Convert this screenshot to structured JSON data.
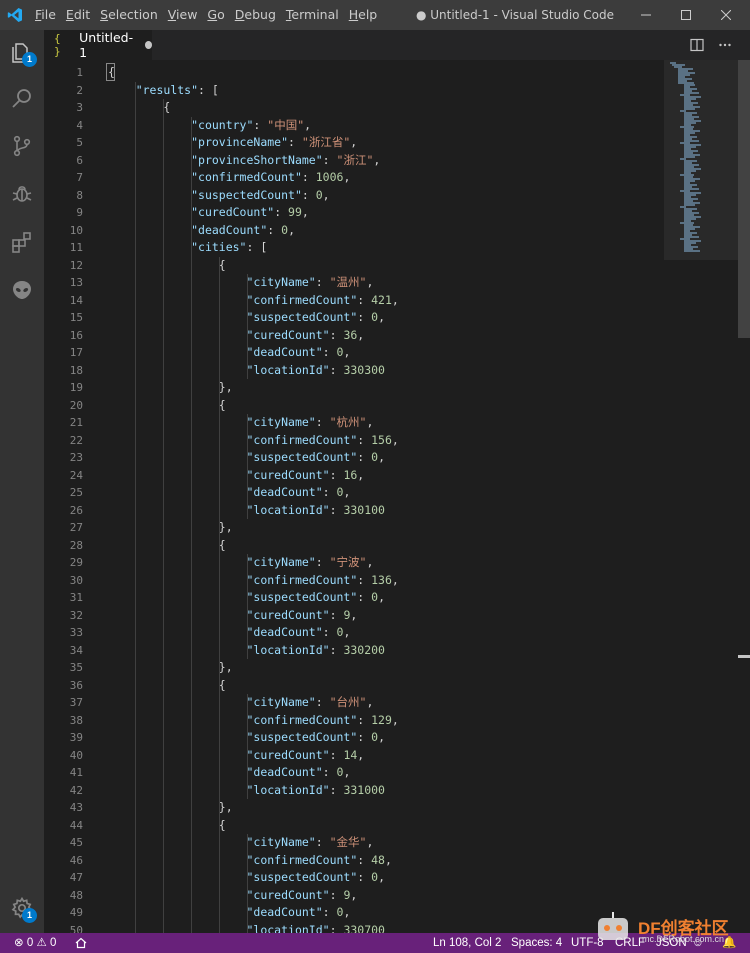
{
  "window": {
    "title": "● Untitled-1 - Visual Studio Code",
    "menu": [
      {
        "label": "File",
        "mnemonic": "F",
        "rest": "ile"
      },
      {
        "label": "Edit",
        "mnemonic": "E",
        "rest": "dit"
      },
      {
        "label": "Selection",
        "mnemonic": "S",
        "rest": "election"
      },
      {
        "label": "View",
        "mnemonic": "V",
        "rest": "iew"
      },
      {
        "label": "Go",
        "mnemonic": "G",
        "rest": "o"
      },
      {
        "label": "Debug",
        "mnemonic": "D",
        "rest": "ebug"
      },
      {
        "label": "Terminal",
        "mnemonic": "T",
        "rest": "erminal"
      },
      {
        "label": "Help",
        "mnemonic": "H",
        "rest": "elp"
      }
    ]
  },
  "activity": {
    "explorer_badge": "1",
    "settings_badge": "1"
  },
  "tab": {
    "icon": "{ }",
    "label": "Untitled-1"
  },
  "editor": {
    "lines": [
      [
        [
          "p",
          "{"
        ]
      ],
      [
        [
          "i",
          "    "
        ],
        [
          "k",
          "\"results\""
        ],
        [
          "p",
          ": ["
        ]
      ],
      [
        [
          "i",
          "        "
        ],
        [
          "p",
          "{"
        ]
      ],
      [
        [
          "i",
          "            "
        ],
        [
          "k",
          "\"country\""
        ],
        [
          "p",
          ": "
        ],
        [
          "s",
          "\"中国\""
        ],
        [
          "p",
          ","
        ]
      ],
      [
        [
          "i",
          "            "
        ],
        [
          "k",
          "\"provinceName\""
        ],
        [
          "p",
          ": "
        ],
        [
          "s",
          "\"浙江省\""
        ],
        [
          "p",
          ","
        ]
      ],
      [
        [
          "i",
          "            "
        ],
        [
          "k",
          "\"provinceShortName\""
        ],
        [
          "p",
          ": "
        ],
        [
          "s",
          "\"浙江\""
        ],
        [
          "p",
          ","
        ]
      ],
      [
        [
          "i",
          "            "
        ],
        [
          "k",
          "\"confirmedCount\""
        ],
        [
          "p",
          ": "
        ],
        [
          "n",
          "1006"
        ],
        [
          "p",
          ","
        ]
      ],
      [
        [
          "i",
          "            "
        ],
        [
          "k",
          "\"suspectedCount\""
        ],
        [
          "p",
          ": "
        ],
        [
          "n",
          "0"
        ],
        [
          "p",
          ","
        ]
      ],
      [
        [
          "i",
          "            "
        ],
        [
          "k",
          "\"curedCount\""
        ],
        [
          "p",
          ": "
        ],
        [
          "n",
          "99"
        ],
        [
          "p",
          ","
        ]
      ],
      [
        [
          "i",
          "            "
        ],
        [
          "k",
          "\"deadCount\""
        ],
        [
          "p",
          ": "
        ],
        [
          "n",
          "0"
        ],
        [
          "p",
          ","
        ]
      ],
      [
        [
          "i",
          "            "
        ],
        [
          "k",
          "\"cities\""
        ],
        [
          "p",
          ": ["
        ]
      ],
      [
        [
          "i",
          "                "
        ],
        [
          "p",
          "{"
        ]
      ],
      [
        [
          "i",
          "                    "
        ],
        [
          "k",
          "\"cityName\""
        ],
        [
          "p",
          ": "
        ],
        [
          "s",
          "\"温州\""
        ],
        [
          "p",
          ","
        ]
      ],
      [
        [
          "i",
          "                    "
        ],
        [
          "k",
          "\"confirmedCount\""
        ],
        [
          "p",
          ": "
        ],
        [
          "n",
          "421"
        ],
        [
          "p",
          ","
        ]
      ],
      [
        [
          "i",
          "                    "
        ],
        [
          "k",
          "\"suspectedCount\""
        ],
        [
          "p",
          ": "
        ],
        [
          "n",
          "0"
        ],
        [
          "p",
          ","
        ]
      ],
      [
        [
          "i",
          "                    "
        ],
        [
          "k",
          "\"curedCount\""
        ],
        [
          "p",
          ": "
        ],
        [
          "n",
          "36"
        ],
        [
          "p",
          ","
        ]
      ],
      [
        [
          "i",
          "                    "
        ],
        [
          "k",
          "\"deadCount\""
        ],
        [
          "p",
          ": "
        ],
        [
          "n",
          "0"
        ],
        [
          "p",
          ","
        ]
      ],
      [
        [
          "i",
          "                    "
        ],
        [
          "k",
          "\"locationId\""
        ],
        [
          "p",
          ": "
        ],
        [
          "n",
          "330300"
        ]
      ],
      [
        [
          "i",
          "                "
        ],
        [
          "p",
          "},"
        ]
      ],
      [
        [
          "i",
          "                "
        ],
        [
          "p",
          "{"
        ]
      ],
      [
        [
          "i",
          "                    "
        ],
        [
          "k",
          "\"cityName\""
        ],
        [
          "p",
          ": "
        ],
        [
          "s",
          "\"杭州\""
        ],
        [
          "p",
          ","
        ]
      ],
      [
        [
          "i",
          "                    "
        ],
        [
          "k",
          "\"confirmedCount\""
        ],
        [
          "p",
          ": "
        ],
        [
          "n",
          "156"
        ],
        [
          "p",
          ","
        ]
      ],
      [
        [
          "i",
          "                    "
        ],
        [
          "k",
          "\"suspectedCount\""
        ],
        [
          "p",
          ": "
        ],
        [
          "n",
          "0"
        ],
        [
          "p",
          ","
        ]
      ],
      [
        [
          "i",
          "                    "
        ],
        [
          "k",
          "\"curedCount\""
        ],
        [
          "p",
          ": "
        ],
        [
          "n",
          "16"
        ],
        [
          "p",
          ","
        ]
      ],
      [
        [
          "i",
          "                    "
        ],
        [
          "k",
          "\"deadCount\""
        ],
        [
          "p",
          ": "
        ],
        [
          "n",
          "0"
        ],
        [
          "p",
          ","
        ]
      ],
      [
        [
          "i",
          "                    "
        ],
        [
          "k",
          "\"locationId\""
        ],
        [
          "p",
          ": "
        ],
        [
          "n",
          "330100"
        ]
      ],
      [
        [
          "i",
          "                "
        ],
        [
          "p",
          "},"
        ]
      ],
      [
        [
          "i",
          "                "
        ],
        [
          "p",
          "{"
        ]
      ],
      [
        [
          "i",
          "                    "
        ],
        [
          "k",
          "\"cityName\""
        ],
        [
          "p",
          ": "
        ],
        [
          "s",
          "\"宁波\""
        ],
        [
          "p",
          ","
        ]
      ],
      [
        [
          "i",
          "                    "
        ],
        [
          "k",
          "\"confirmedCount\""
        ],
        [
          "p",
          ": "
        ],
        [
          "n",
          "136"
        ],
        [
          "p",
          ","
        ]
      ],
      [
        [
          "i",
          "                    "
        ],
        [
          "k",
          "\"suspectedCount\""
        ],
        [
          "p",
          ": "
        ],
        [
          "n",
          "0"
        ],
        [
          "p",
          ","
        ]
      ],
      [
        [
          "i",
          "                    "
        ],
        [
          "k",
          "\"curedCount\""
        ],
        [
          "p",
          ": "
        ],
        [
          "n",
          "9"
        ],
        [
          "p",
          ","
        ]
      ],
      [
        [
          "i",
          "                    "
        ],
        [
          "k",
          "\"deadCount\""
        ],
        [
          "p",
          ": "
        ],
        [
          "n",
          "0"
        ],
        [
          "p",
          ","
        ]
      ],
      [
        [
          "i",
          "                    "
        ],
        [
          "k",
          "\"locationId\""
        ],
        [
          "p",
          ": "
        ],
        [
          "n",
          "330200"
        ]
      ],
      [
        [
          "i",
          "                "
        ],
        [
          "p",
          "},"
        ]
      ],
      [
        [
          "i",
          "                "
        ],
        [
          "p",
          "{"
        ]
      ],
      [
        [
          "i",
          "                    "
        ],
        [
          "k",
          "\"cityName\""
        ],
        [
          "p",
          ": "
        ],
        [
          "s",
          "\"台州\""
        ],
        [
          "p",
          ","
        ]
      ],
      [
        [
          "i",
          "                    "
        ],
        [
          "k",
          "\"confirmedCount\""
        ],
        [
          "p",
          ": "
        ],
        [
          "n",
          "129"
        ],
        [
          "p",
          ","
        ]
      ],
      [
        [
          "i",
          "                    "
        ],
        [
          "k",
          "\"suspectedCount\""
        ],
        [
          "p",
          ": "
        ],
        [
          "n",
          "0"
        ],
        [
          "p",
          ","
        ]
      ],
      [
        [
          "i",
          "                    "
        ],
        [
          "k",
          "\"curedCount\""
        ],
        [
          "p",
          ": "
        ],
        [
          "n",
          "14"
        ],
        [
          "p",
          ","
        ]
      ],
      [
        [
          "i",
          "                    "
        ],
        [
          "k",
          "\"deadCount\""
        ],
        [
          "p",
          ": "
        ],
        [
          "n",
          "0"
        ],
        [
          "p",
          ","
        ]
      ],
      [
        [
          "i",
          "                    "
        ],
        [
          "k",
          "\"locationId\""
        ],
        [
          "p",
          ": "
        ],
        [
          "n",
          "331000"
        ]
      ],
      [
        [
          "i",
          "                "
        ],
        [
          "p",
          "},"
        ]
      ],
      [
        [
          "i",
          "                "
        ],
        [
          "p",
          "{"
        ]
      ],
      [
        [
          "i",
          "                    "
        ],
        [
          "k",
          "\"cityName\""
        ],
        [
          "p",
          ": "
        ],
        [
          "s",
          "\"金华\""
        ],
        [
          "p",
          ","
        ]
      ],
      [
        [
          "i",
          "                    "
        ],
        [
          "k",
          "\"confirmedCount\""
        ],
        [
          "p",
          ": "
        ],
        [
          "n",
          "48"
        ],
        [
          "p",
          ","
        ]
      ],
      [
        [
          "i",
          "                    "
        ],
        [
          "k",
          "\"suspectedCount\""
        ],
        [
          "p",
          ": "
        ],
        [
          "n",
          "0"
        ],
        [
          "p",
          ","
        ]
      ],
      [
        [
          "i",
          "                    "
        ],
        [
          "k",
          "\"curedCount\""
        ],
        [
          "p",
          ": "
        ],
        [
          "n",
          "9"
        ],
        [
          "p",
          ","
        ]
      ],
      [
        [
          "i",
          "                    "
        ],
        [
          "k",
          "\"deadCount\""
        ],
        [
          "p",
          ": "
        ],
        [
          "n",
          "0"
        ],
        [
          "p",
          ","
        ]
      ],
      [
        [
          "i",
          "                    "
        ],
        [
          "k",
          "\"locationId\""
        ],
        [
          "p",
          ": "
        ],
        [
          "n",
          "330700"
        ]
      ]
    ]
  },
  "statusbar": {
    "errors": "0",
    "warnings": "0",
    "position": "Ln 108, Col 2",
    "spaces": "Spaces: 4",
    "encoding": "UTF-8",
    "eol": "CRLF",
    "language": "JSON"
  },
  "watermark": {
    "brand": "DF创客社区",
    "url": "mc.DFRobot.com.cn"
  },
  "colors": {
    "statusbar": "#68217a",
    "accent": "#007acc",
    "key": "#9cdcfe",
    "string": "#ce9178",
    "number": "#b5cea8"
  }
}
